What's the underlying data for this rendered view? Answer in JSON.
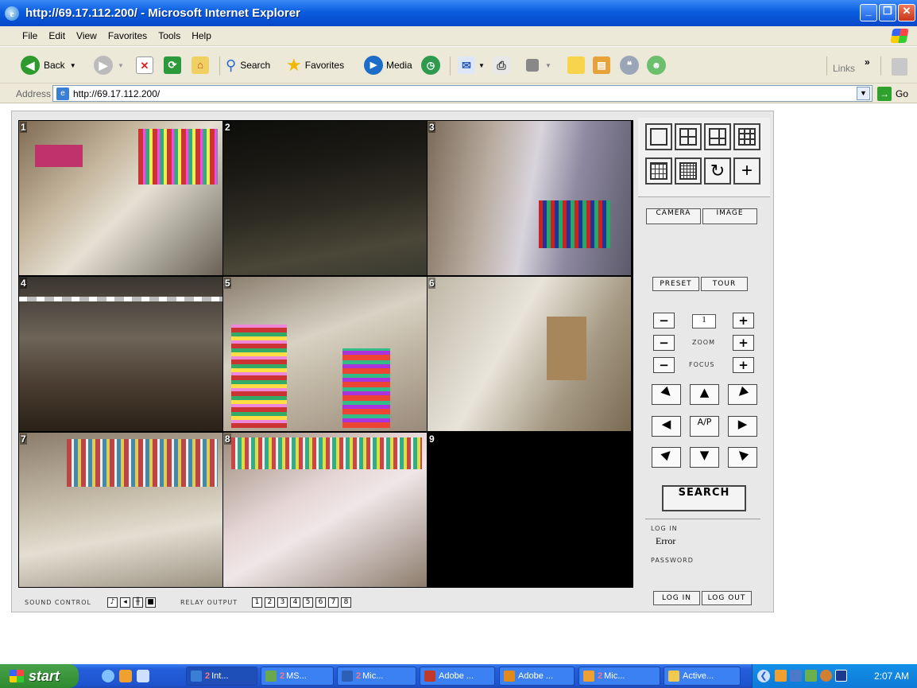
{
  "window": {
    "title": "http://69.17.112.200/ - Microsoft Internet Explorer",
    "controls": [
      "minimize",
      "restore",
      "close"
    ]
  },
  "menu": [
    "File",
    "Edit",
    "View",
    "Favorites",
    "Tools",
    "Help"
  ],
  "toolbar": {
    "back_label": "Back",
    "search_label": "Search",
    "favorites_label": "Favorites",
    "media_label": "Media",
    "links_label": "Links"
  },
  "address": {
    "label": "Address",
    "url": "http://69.17.112.200/",
    "go_label": "Go"
  },
  "viewer": {
    "cameras": [
      {
        "num": "1",
        "scene": "store-interior"
      },
      {
        "num": "2",
        "scene": "dark-parking-lot"
      },
      {
        "num": "3",
        "scene": "stock-aisle"
      },
      {
        "num": "4",
        "scene": "fuel-canopy-night"
      },
      {
        "num": "5",
        "scene": "store-aisle"
      },
      {
        "num": "6",
        "scene": "back-room"
      },
      {
        "num": "7",
        "scene": "counter-area"
      },
      {
        "num": "8",
        "scene": "checkout"
      },
      {
        "num": "9",
        "scene": "no-signal"
      }
    ],
    "layout_buttons": [
      "single-view",
      "quad-view",
      "six-view",
      "nine-view",
      "twelve-view",
      "sixteen-view",
      "rotate-sequence",
      "add-view"
    ],
    "camera_label": "CAMERA",
    "image_label": "IMAGE",
    "preset_label": "PRESET",
    "tour_label": "TOUR",
    "preset_value": "1",
    "zoom_label": "ZOOM",
    "focus_label": "FOCUS",
    "ap_label": "A/P",
    "search_label": "SEARCH",
    "login_label": "LOG IN",
    "login_value": "Error",
    "password_label": "PASSWORD",
    "login_btn": "LOG IN",
    "logout_btn": "LOG OUT",
    "sound_label": "SOUND CONTROL",
    "relay_label": "RELAY OUTPUT",
    "relays": [
      "1",
      "2",
      "3",
      "4",
      "5",
      "6",
      "7",
      "8"
    ]
  },
  "taskbar": {
    "start_label": "start",
    "tasks": [
      {
        "num": "2",
        "label": "Int...",
        "color": "#3a7fd6"
      },
      {
        "num": "2",
        "label": "MS...",
        "color": "#6aa84f"
      },
      {
        "num": "2",
        "label": "Mic...",
        "color": "#2b5fb8"
      },
      {
        "num": "",
        "label": "Adobe ...",
        "color": "#c0392b"
      },
      {
        "num": "",
        "label": "Adobe ...",
        "color": "#e08a1e"
      },
      {
        "num": "2",
        "label": "Mic...",
        "color": "#f0a030"
      },
      {
        "num": "",
        "label": "Active...",
        "color": "#f2c94c"
      }
    ],
    "clock": "2:07 AM"
  }
}
